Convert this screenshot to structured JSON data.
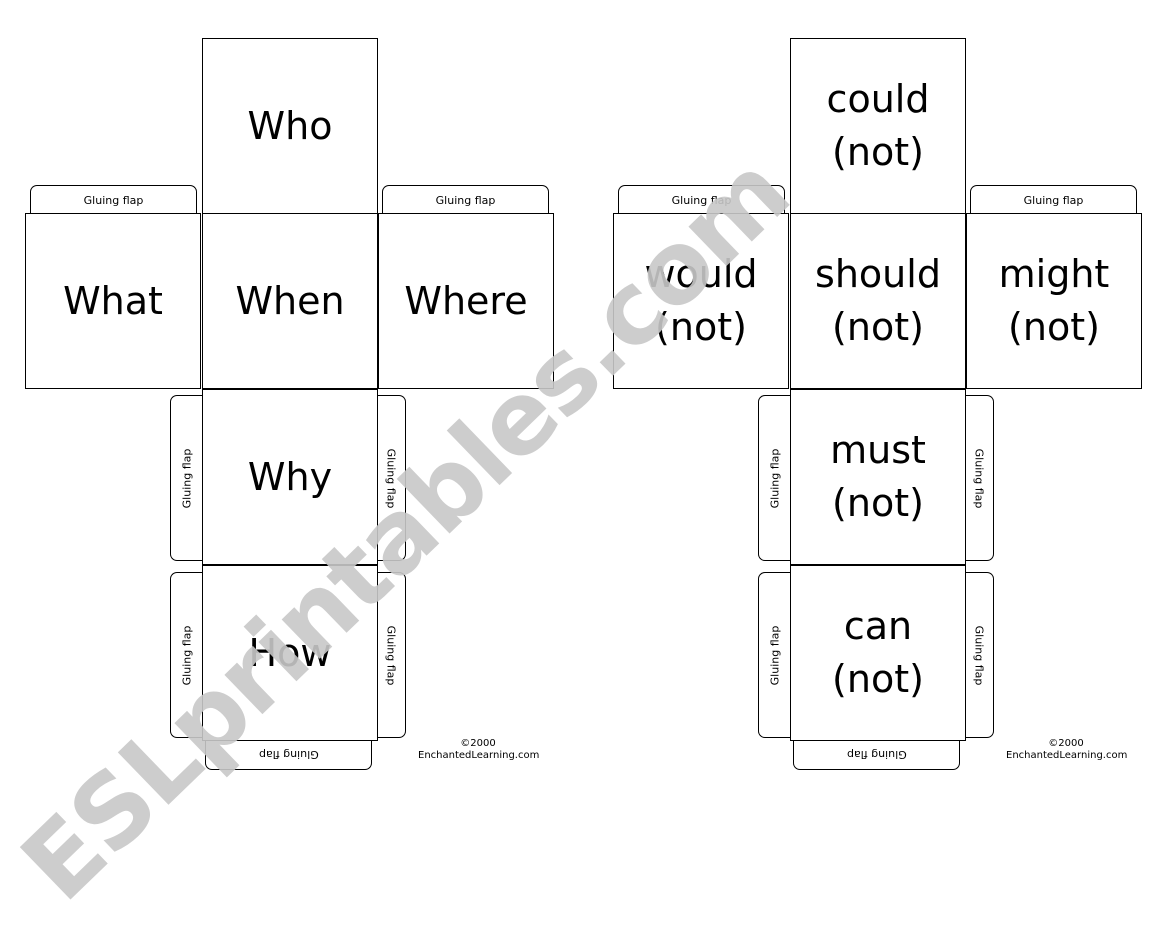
{
  "flap_label": "Gluing flap",
  "copyright": {
    "year": "©2000",
    "site": "EnchantedLearning.com"
  },
  "watermark": "ESLprintables.com",
  "cubes": [
    {
      "top": [
        "Who"
      ],
      "left": [
        "What"
      ],
      "center": [
        "When"
      ],
      "right": [
        "Where"
      ],
      "below1": [
        "Why"
      ],
      "below2": [
        "How"
      ]
    },
    {
      "top": [
        "could",
        "(not)"
      ],
      "left": [
        "would",
        "(not)"
      ],
      "center": [
        "should",
        "(not)"
      ],
      "right": [
        "might",
        "(not)"
      ],
      "below1": [
        "must",
        "(not)"
      ],
      "below2": [
        "can",
        "(not)"
      ]
    }
  ]
}
